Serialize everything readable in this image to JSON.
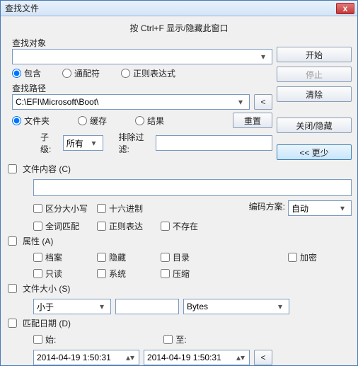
{
  "titlebar": {
    "title": "查找文件",
    "close_icon": "x"
  },
  "hint": "按 Ctrl+F 显示/隐藏此窗口",
  "search_target": {
    "label": "查找对象",
    "value": "",
    "contains": "包含",
    "wildcard": "通配符",
    "regex": "正则表达式"
  },
  "search_path": {
    "label": "查找路径",
    "value": "C:\\EFI\\Microsoft\\Boot\\",
    "browse": "<",
    "folder": "文件夹",
    "cache": "缓存",
    "result": "结果",
    "reset": "重置"
  },
  "subfolder": {
    "label": "子级:",
    "value": "所有",
    "exclude_label": "排除过滤:",
    "exclude_value": ""
  },
  "right_buttons": {
    "start": "开始",
    "stop": "停止",
    "clear": "清除",
    "close_hide": "关闭/隐藏",
    "less": "<< 更少"
  },
  "content": {
    "title": "文件内容 (C)",
    "value": "",
    "case": "区分大小写",
    "hex": "十六进制",
    "encoding_label": "编码方案:",
    "encoding_value": "自动",
    "whole": "全词匹配",
    "regex": "正则表达",
    "not_exist": "不存在"
  },
  "attrs": {
    "title": "属性 (A)",
    "archive": "档案",
    "hidden": "隐藏",
    "directory": "目录",
    "encrypted": "加密",
    "readonly": "只读",
    "system": "系统",
    "compressed": "压缩"
  },
  "size": {
    "title": "文件大小 (S)",
    "op": "小于",
    "value": "",
    "unit": "Bytes"
  },
  "date": {
    "title": "匹配日期 (D)",
    "from_label": "始:",
    "to_label": "至:",
    "from": "2014-04-19  1:50:31",
    "to": "2014-04-19  1:50:31",
    "picker": "<"
  }
}
